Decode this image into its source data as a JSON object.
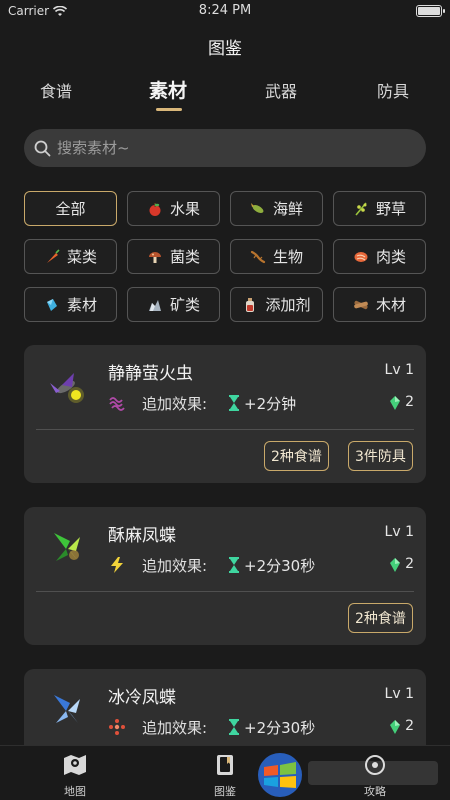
{
  "status": {
    "carrier": "Carrier",
    "time": "8:24 PM"
  },
  "header": {
    "title": "图鉴"
  },
  "tabs": [
    {
      "label": "食谱"
    },
    {
      "label": "素材"
    },
    {
      "label": "武器"
    },
    {
      "label": "防具"
    }
  ],
  "active_tab": "素材",
  "search": {
    "placeholder": "搜索素材~",
    "value": ""
  },
  "chips": [
    {
      "label": "全部",
      "icon": "none",
      "active": true
    },
    {
      "label": "水果",
      "icon": "apple-icon"
    },
    {
      "label": "海鲜",
      "icon": "fish-icon"
    },
    {
      "label": "野草",
      "icon": "herb-icon"
    },
    {
      "label": "菜类",
      "icon": "carrot-icon"
    },
    {
      "label": "菌类",
      "icon": "mushroom-icon"
    },
    {
      "label": "生物",
      "icon": "lizard-icon"
    },
    {
      "label": "肉类",
      "icon": "meat-icon"
    },
    {
      "label": "素材",
      "icon": "crystal-icon"
    },
    {
      "label": "矿类",
      "icon": "ore-icon"
    },
    {
      "label": "添加剂",
      "icon": "bottle-icon"
    },
    {
      "label": "木材",
      "icon": "wood-icon"
    }
  ],
  "cards": [
    {
      "name": "静静萤火虫",
      "level": "Lv 1",
      "effect_label": "追加效果:",
      "effect_value": "+2分钟",
      "effect_icon": "stealth-wave-icon",
      "gem_count": "2",
      "tags": [
        "2种食谱",
        "3件防具"
      ]
    },
    {
      "name": "酥麻凤蝶",
      "level": "Lv 1",
      "effect_label": "追加效果:",
      "effect_value": "+2分30秒",
      "effect_icon": "lightning-icon",
      "gem_count": "2",
      "tags": [
        "2种食谱"
      ]
    },
    {
      "name": "冰冷凤蝶",
      "level": "Lv 1",
      "effect_label": "追加效果:",
      "effect_value": "+2分30秒",
      "effect_icon": "cold-resist-icon",
      "gem_count": "2",
      "tags": []
    }
  ],
  "bottom_nav": [
    {
      "label": "地图",
      "icon": "map-icon"
    },
    {
      "label": "图鉴",
      "icon": "book-icon"
    },
    {
      "label": "攻略",
      "icon": "guide-icon"
    }
  ],
  "colors": {
    "accent": "#c9a96a",
    "background": "#1b1b1b",
    "card": "#2f2f2f",
    "hourglass": "#3fd6a0",
    "gem": "#44d07a"
  }
}
